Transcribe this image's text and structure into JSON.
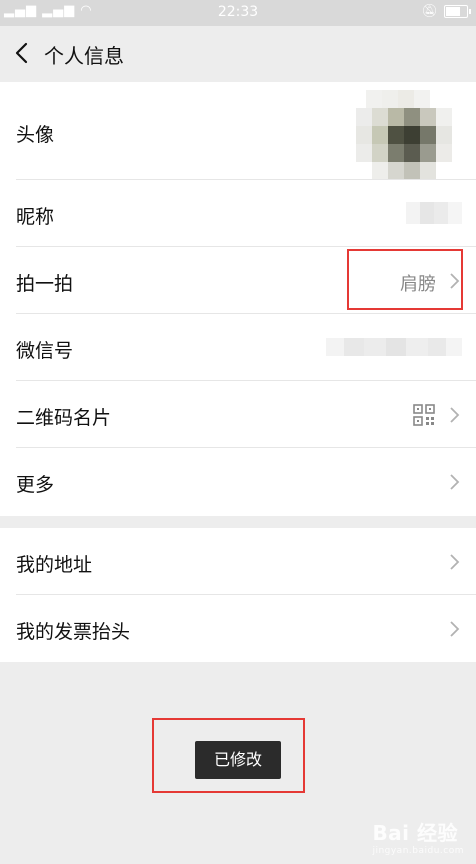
{
  "status_bar": {
    "time": "22:33"
  },
  "nav": {
    "title": "个人信息"
  },
  "profile": {
    "rows": [
      {
        "label": "头像"
      },
      {
        "label": "昵称"
      },
      {
        "label": "拍一拍",
        "value": "肩膀"
      },
      {
        "label": "微信号"
      },
      {
        "label": "二维码名片"
      },
      {
        "label": "更多"
      }
    ]
  },
  "extra": {
    "rows": [
      {
        "label": "我的地址"
      },
      {
        "label": "我的发票抬头"
      }
    ]
  },
  "toast": {
    "text": "已修改"
  },
  "watermark": {
    "text": "Bai 经验",
    "sub": "jingyan.baidu.com"
  },
  "colors": {
    "highlight": "#e53935",
    "background": "#ededed"
  }
}
